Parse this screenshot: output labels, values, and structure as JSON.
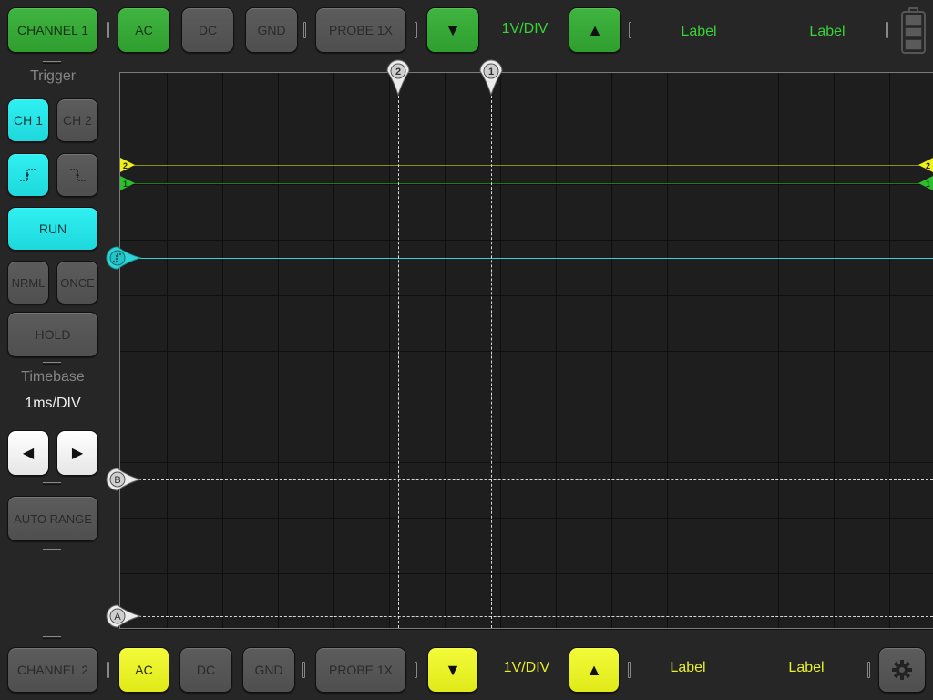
{
  "top_bar": {
    "channel_label": "CHANNEL 1",
    "coupling": [
      "AC",
      "DC",
      "GND"
    ],
    "coupling_selected": "AC",
    "probe_label": "PROBE 1X",
    "volts_per_div": "1V/DIV",
    "label_1": "Label",
    "label_2": "Label",
    "accent_color": "#39b339",
    "battery_icon": "battery-icon"
  },
  "sidebar": {
    "trigger_title": "Trigger",
    "trigger_channels": [
      "CH 1",
      "CH 2"
    ],
    "trigger_channel_selected": "CH 1",
    "trigger_edge_selected": "rising",
    "run_label": "RUN",
    "mode_buttons": [
      "NRML",
      "ONCE"
    ],
    "hold_label": "HOLD",
    "timebase_title": "Timebase",
    "timebase_value": "1ms/DIV",
    "auto_range_label": "AUTO RANGE",
    "accent_color": "#22e4e8"
  },
  "scope": {
    "cursors_vertical": [
      "2",
      "1"
    ],
    "cursors_horizontal": [
      "B",
      "A"
    ],
    "channel_markers": [
      "2",
      "1"
    ]
  },
  "bottom_bar": {
    "channel_label": "CHANNEL 2",
    "coupling": [
      "AC",
      "DC",
      "GND"
    ],
    "coupling_selected": "AC",
    "probe_label": "PROBE 1X",
    "volts_per_div": "1V/DIV",
    "label_1": "Label",
    "label_2": "Label",
    "accent_color": "#ecf21f",
    "settings_icon": "gear-icon"
  }
}
